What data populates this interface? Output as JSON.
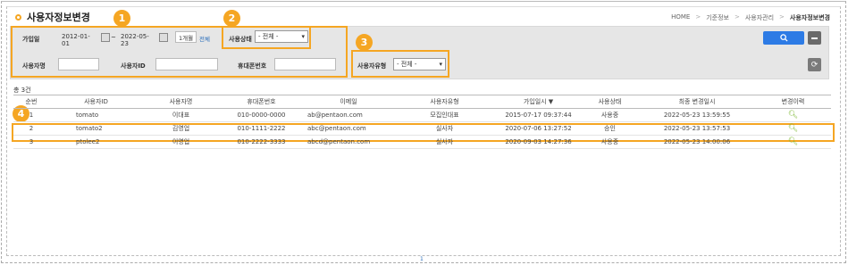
{
  "page": {
    "title": "사용자정보변경",
    "breadcrumb": [
      "HOME",
      "기준정보",
      "사용자관리",
      "사용자정보변경"
    ]
  },
  "search": {
    "join_date_label": "가입일",
    "date_from": "2012-01-01",
    "date_to": "2022-05-23",
    "tilde": "~",
    "one_month_label": "1개월",
    "all_label": "전체",
    "status_label": "사용상태",
    "status_value": "- 전체 -",
    "user_name_label": "사용자명",
    "user_id_label": "사용자ID",
    "phone_label": "휴대폰번호",
    "user_type_label": "사용자유형",
    "user_type_value": "- 전체 -"
  },
  "badges": [
    "1",
    "2",
    "3",
    "4"
  ],
  "icons": {
    "search": "search-icon",
    "minus": "minus-icon",
    "refresh": "refresh-icon",
    "history": "magnifier-icon",
    "calendar": "calendar-icon"
  },
  "colors": {
    "highlight": "#f5a623",
    "primary": "#2d7be5"
  },
  "table": {
    "count_label": "총 3건",
    "headers": [
      "순번",
      "사용자ID",
      "사용자명",
      "휴대폰번호",
      "이메일",
      "사용자유형",
      "가입일시 ▼",
      "사용상태",
      "최종 변경일시",
      "변경이력"
    ],
    "rows": [
      [
        "1",
        "tomato",
        "이대표",
        "010-0000-0000",
        "ab@pentaon.com",
        "모집인대표",
        "2015-07-17 09:37:44",
        "사용중",
        "2022-05-23 13:59:55"
      ],
      [
        "2",
        "tomato2",
        "김영업",
        "010-1111-2222",
        "abc@pentaon.com",
        "실사자",
        "2020-07-06 13:27:52",
        "승인",
        "2022-05-23 13:57:53"
      ],
      [
        "3",
        "ptolee2",
        "이영업",
        "010-2222-3333",
        "abcd@pentaon.com",
        "실사자",
        "2020-09-03 14:27:36",
        "사용중",
        "2022-05-23 14:00:06"
      ]
    ]
  },
  "pagination": {
    "current": "1"
  }
}
